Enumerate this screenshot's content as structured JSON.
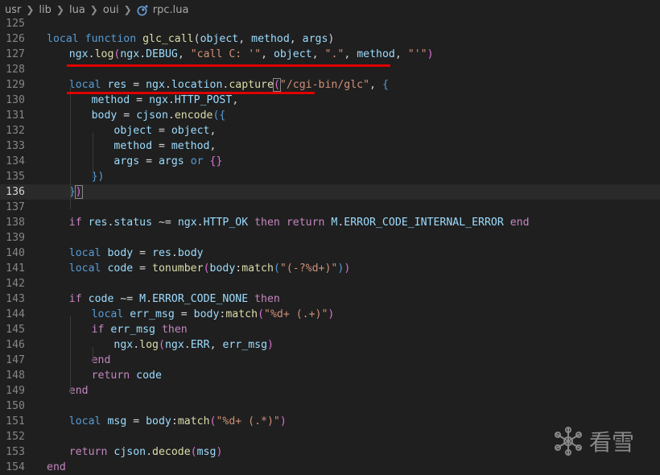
{
  "breadcrumb": {
    "segments": [
      "usr",
      "lib",
      "lua",
      "oui"
    ],
    "file": "rpc.lua"
  },
  "editor": {
    "active_line": "136",
    "lines": [
      {
        "n": "125",
        "tokens": []
      },
      {
        "n": "126",
        "tokens": [
          [
            "k",
            "local "
          ],
          [
            "k",
            "function "
          ],
          [
            "f",
            "glc_call"
          ],
          [
            "p",
            "("
          ],
          [
            "v",
            "object"
          ],
          [
            "p",
            ", "
          ],
          [
            "v",
            "method"
          ],
          [
            "p",
            ", "
          ],
          [
            "v",
            "args"
          ],
          [
            "p",
            ")"
          ]
        ]
      },
      {
        "n": "127",
        "tokens": [
          [
            "v",
            "ngx"
          ],
          [
            "p",
            "."
          ],
          [
            "f",
            "log"
          ],
          [
            "pr",
            "("
          ],
          [
            "v",
            "ngx"
          ],
          [
            "p",
            "."
          ],
          [
            "v",
            "DEBUG"
          ],
          [
            "p",
            ", "
          ],
          [
            "s",
            "\"call C: '\""
          ],
          [
            "p",
            ", "
          ],
          [
            "v",
            "object"
          ],
          [
            "p",
            ", "
          ],
          [
            "s",
            "\".\""
          ],
          [
            "p",
            ", "
          ],
          [
            "v",
            "method"
          ],
          [
            "p",
            ", "
          ],
          [
            "s",
            "\"'\""
          ],
          [
            "pr",
            ")"
          ]
        ]
      },
      {
        "n": "128",
        "tokens": []
      },
      {
        "n": "129",
        "tokens": [
          [
            "k",
            "local "
          ],
          [
            "v",
            "res"
          ],
          [
            "p",
            " = "
          ],
          [
            "v",
            "ngx"
          ],
          [
            "p",
            "."
          ],
          [
            "v",
            "location"
          ],
          [
            "p",
            "."
          ],
          [
            "f",
            "capture"
          ],
          [
            "pr",
            "("
          ],
          [
            "s",
            "\"/cgi-bin/glc\""
          ],
          [
            "p",
            ", "
          ],
          [
            "k",
            "{"
          ]
        ]
      },
      {
        "n": "130",
        "tokens": [
          [
            "v",
            "method"
          ],
          [
            "p",
            " = "
          ],
          [
            "v",
            "ngx"
          ],
          [
            "p",
            "."
          ],
          [
            "v",
            "HTTP_POST"
          ],
          [
            "p",
            ","
          ]
        ]
      },
      {
        "n": "131",
        "tokens": [
          [
            "v",
            "body"
          ],
          [
            "p",
            " = "
          ],
          [
            "v",
            "cjson"
          ],
          [
            "p",
            "."
          ],
          [
            "f",
            "encode"
          ],
          [
            "k",
            "({"
          ]
        ]
      },
      {
        "n": "132",
        "tokens": [
          [
            "v",
            "object"
          ],
          [
            "p",
            " = "
          ],
          [
            "v",
            "object"
          ],
          [
            "p",
            ","
          ]
        ]
      },
      {
        "n": "133",
        "tokens": [
          [
            "v",
            "method"
          ],
          [
            "p",
            " = "
          ],
          [
            "v",
            "method"
          ],
          [
            "p",
            ","
          ]
        ]
      },
      {
        "n": "134",
        "tokens": [
          [
            "v",
            "args"
          ],
          [
            "p",
            " = "
          ],
          [
            "v",
            "args"
          ],
          [
            "p",
            " "
          ],
          [
            "k",
            "or"
          ],
          [
            "p",
            " "
          ],
          [
            "pr",
            "{}"
          ]
        ]
      },
      {
        "n": "135",
        "tokens": [
          [
            "k",
            "})"
          ]
        ]
      },
      {
        "n": "136",
        "tokens": [
          [
            "k",
            "}"
          ],
          [
            "pr",
            ")"
          ]
        ]
      },
      {
        "n": "137",
        "tokens": []
      },
      {
        "n": "138",
        "tokens": [
          [
            "c",
            "if "
          ],
          [
            "v",
            "res"
          ],
          [
            "p",
            "."
          ],
          [
            "v",
            "status"
          ],
          [
            "p",
            " ~= "
          ],
          [
            "v",
            "ngx"
          ],
          [
            "p",
            "."
          ],
          [
            "v",
            "HTTP_OK"
          ],
          [
            "c",
            " then "
          ],
          [
            "c",
            "return "
          ],
          [
            "v",
            "M"
          ],
          [
            "p",
            "."
          ],
          [
            "v",
            "ERROR_CODE_INTERNAL_ERROR"
          ],
          [
            "c",
            " end"
          ]
        ]
      },
      {
        "n": "139",
        "tokens": []
      },
      {
        "n": "140",
        "tokens": [
          [
            "k",
            "local "
          ],
          [
            "v",
            "body"
          ],
          [
            "p",
            " = "
          ],
          [
            "v",
            "res"
          ],
          [
            "p",
            "."
          ],
          [
            "v",
            "body"
          ]
        ]
      },
      {
        "n": "141",
        "tokens": [
          [
            "k",
            "local "
          ],
          [
            "v",
            "code"
          ],
          [
            "p",
            " = "
          ],
          [
            "f",
            "tonumber"
          ],
          [
            "pr",
            "("
          ],
          [
            "v",
            "body"
          ],
          [
            "p",
            ":"
          ],
          [
            "f",
            "match"
          ],
          [
            "k",
            "("
          ],
          [
            "s",
            "\"(-?%d+)\""
          ],
          [
            "k",
            ")"
          ],
          [
            "pr",
            ")"
          ]
        ]
      },
      {
        "n": "142",
        "tokens": []
      },
      {
        "n": "143",
        "tokens": [
          [
            "c",
            "if "
          ],
          [
            "v",
            "code"
          ],
          [
            "p",
            " ~= "
          ],
          [
            "v",
            "M"
          ],
          [
            "p",
            "."
          ],
          [
            "v",
            "ERROR_CODE_NONE"
          ],
          [
            "c",
            " then"
          ]
        ]
      },
      {
        "n": "144",
        "tokens": [
          [
            "k",
            "local "
          ],
          [
            "v",
            "err_msg"
          ],
          [
            "p",
            " = "
          ],
          [
            "v",
            "body"
          ],
          [
            "p",
            ":"
          ],
          [
            "f",
            "match"
          ],
          [
            "pr",
            "("
          ],
          [
            "s",
            "\"%d+ (.+)\""
          ],
          [
            "pr",
            ")"
          ]
        ]
      },
      {
        "n": "145",
        "tokens": [
          [
            "c",
            "if "
          ],
          [
            "v",
            "err_msg"
          ],
          [
            "c",
            " then"
          ]
        ]
      },
      {
        "n": "146",
        "tokens": [
          [
            "v",
            "ngx"
          ],
          [
            "p",
            "."
          ],
          [
            "f",
            "log"
          ],
          [
            "pr",
            "("
          ],
          [
            "v",
            "ngx"
          ],
          [
            "p",
            "."
          ],
          [
            "v",
            "ERR"
          ],
          [
            "p",
            ", "
          ],
          [
            "v",
            "err_msg"
          ],
          [
            "pr",
            ")"
          ]
        ]
      },
      {
        "n": "147",
        "tokens": [
          [
            "c",
            "end"
          ]
        ]
      },
      {
        "n": "148",
        "tokens": [
          [
            "c",
            "return "
          ],
          [
            "v",
            "code"
          ]
        ]
      },
      {
        "n": "149",
        "tokens": [
          [
            "c",
            "end"
          ]
        ]
      },
      {
        "n": "150",
        "tokens": []
      },
      {
        "n": "151",
        "tokens": [
          [
            "k",
            "local "
          ],
          [
            "v",
            "msg"
          ],
          [
            "p",
            " = "
          ],
          [
            "v",
            "body"
          ],
          [
            "p",
            ":"
          ],
          [
            "f",
            "match"
          ],
          [
            "pr",
            "("
          ],
          [
            "s",
            "\"%d+ (.*)\""
          ],
          [
            "pr",
            ")"
          ]
        ]
      },
      {
        "n": "152",
        "tokens": []
      },
      {
        "n": "153",
        "tokens": [
          [
            "c",
            "return "
          ],
          [
            "v",
            "cjson"
          ],
          [
            "p",
            "."
          ],
          [
            "f",
            "decode"
          ],
          [
            "pr",
            "("
          ],
          [
            "v",
            "msg"
          ],
          [
            "pr",
            ")"
          ]
        ]
      },
      {
        "n": "154",
        "tokens": [
          [
            "c",
            "end"
          ]
        ]
      }
    ]
  },
  "watermark": {
    "text": "看雪",
    "icon": "snowflake-icon"
  },
  "colors": {
    "background": "#1f1f1f",
    "keyword": "#569cd6",
    "control": "#c586c0",
    "function": "#dcdcaa",
    "string": "#ce9178",
    "variable": "#9cdcfe",
    "underline": "#e00000"
  }
}
